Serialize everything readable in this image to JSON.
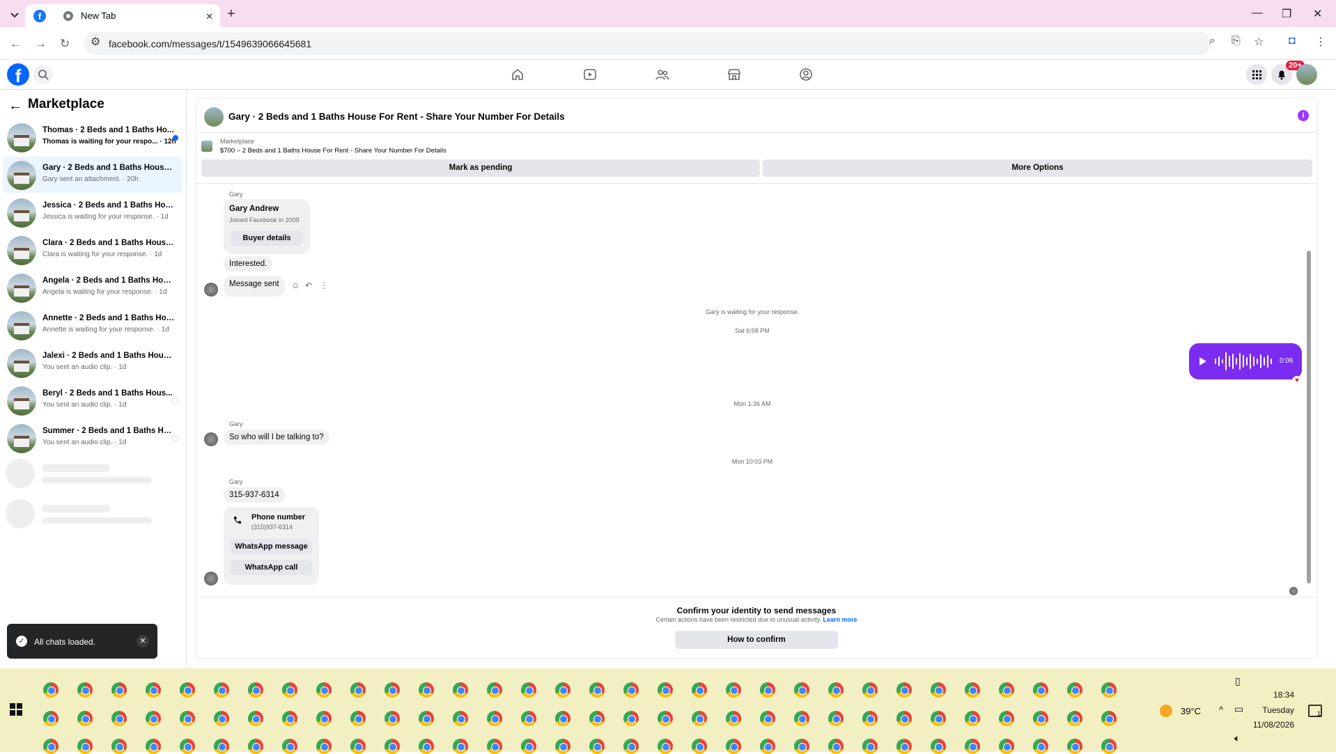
{
  "browser": {
    "tabs": [
      {
        "title": ""
      },
      {
        "title": "New Tab"
      }
    ],
    "url": "facebook.com/messages/t/1549639066645681"
  },
  "facebook": {
    "notification_badge": "20+"
  },
  "sidebar": {
    "title": "Marketplace",
    "conversations": [
      {
        "name": "Thomas · 2 Beds and 1 Baths Ho...",
        "sub": "Thomas is waiting for your respo... · 12h",
        "unread": true
      },
      {
        "name": "Gary · 2 Beds and 1 Baths House F...",
        "sub": "Gary sent an attachment. · 20h",
        "selected": true
      },
      {
        "name": "Jessica · 2 Beds and 1 Baths House ...",
        "sub": "Jessica is waiting for your response. · 1d"
      },
      {
        "name": "Clara · 2 Beds and 1 Baths House F...",
        "sub": "Clara is waiting for your response. · 1d"
      },
      {
        "name": "Angela · 2 Beds and 1 Baths House...",
        "sub": "Angela is waiting for your response. · 1d"
      },
      {
        "name": "Annette · 2 Beds and 1 Baths Hous...",
        "sub": "Annette is waiting for your response. · 1d"
      },
      {
        "name": "Jalexi · 2 Beds and 1 Baths House F...",
        "sub": "You sent an audio clip. · 1d"
      },
      {
        "name": "Beryl · 2 Beds and 1 Baths Hous...",
        "sub": "You sent an audio clip. · 1d"
      },
      {
        "name": "Summer · 2 Beds and 1 Baths Ho...",
        "sub": "You sent an audio clip. · 1d"
      }
    ]
  },
  "toast": {
    "text": "All chats loaded."
  },
  "chat": {
    "title": "Gary · 2 Beds and 1 Baths House For Rent - Share Your Number For Details",
    "marketplace_label": "Marketplace",
    "listing": "$700 – 2 Beds and 1 Baths House For Rent - Share Your Number For Details",
    "mark_pending": "Mark as pending",
    "more_options": "More Options",
    "sender": "Gary",
    "profile": {
      "name": "Gary Andrew",
      "joined": "Joined Facebook in 2009",
      "button": "Buyer details"
    },
    "msg_interested": "Interested.",
    "msg_sent": "Message sent",
    "waiting": "Gary is waiting for your response.",
    "time1": "Sat 6:58 PM",
    "audio_duration": "0:06",
    "time2": "Mon 1:36 AM",
    "msg_who": "So who will I be talking to?",
    "time3": "Mon 10:03 PM",
    "msg_phone": "315-937-6314",
    "phone_card": {
      "label": "Phone number",
      "value": "(315)937-6314",
      "whatsapp_message": "WhatsApp message",
      "whatsapp_call": "WhatsApp call"
    },
    "confirm_title": "Confirm your identity to send messages",
    "confirm_sub": "Certain actions have been restricted due to unusual activity.",
    "learn_more": "Learn more",
    "confirm_button": "How to confirm"
  },
  "taskbar": {
    "temperature": "39°C",
    "time": "18:34",
    "day": "Tuesday",
    "date": "11/08/2026",
    "notif_count": "1"
  }
}
